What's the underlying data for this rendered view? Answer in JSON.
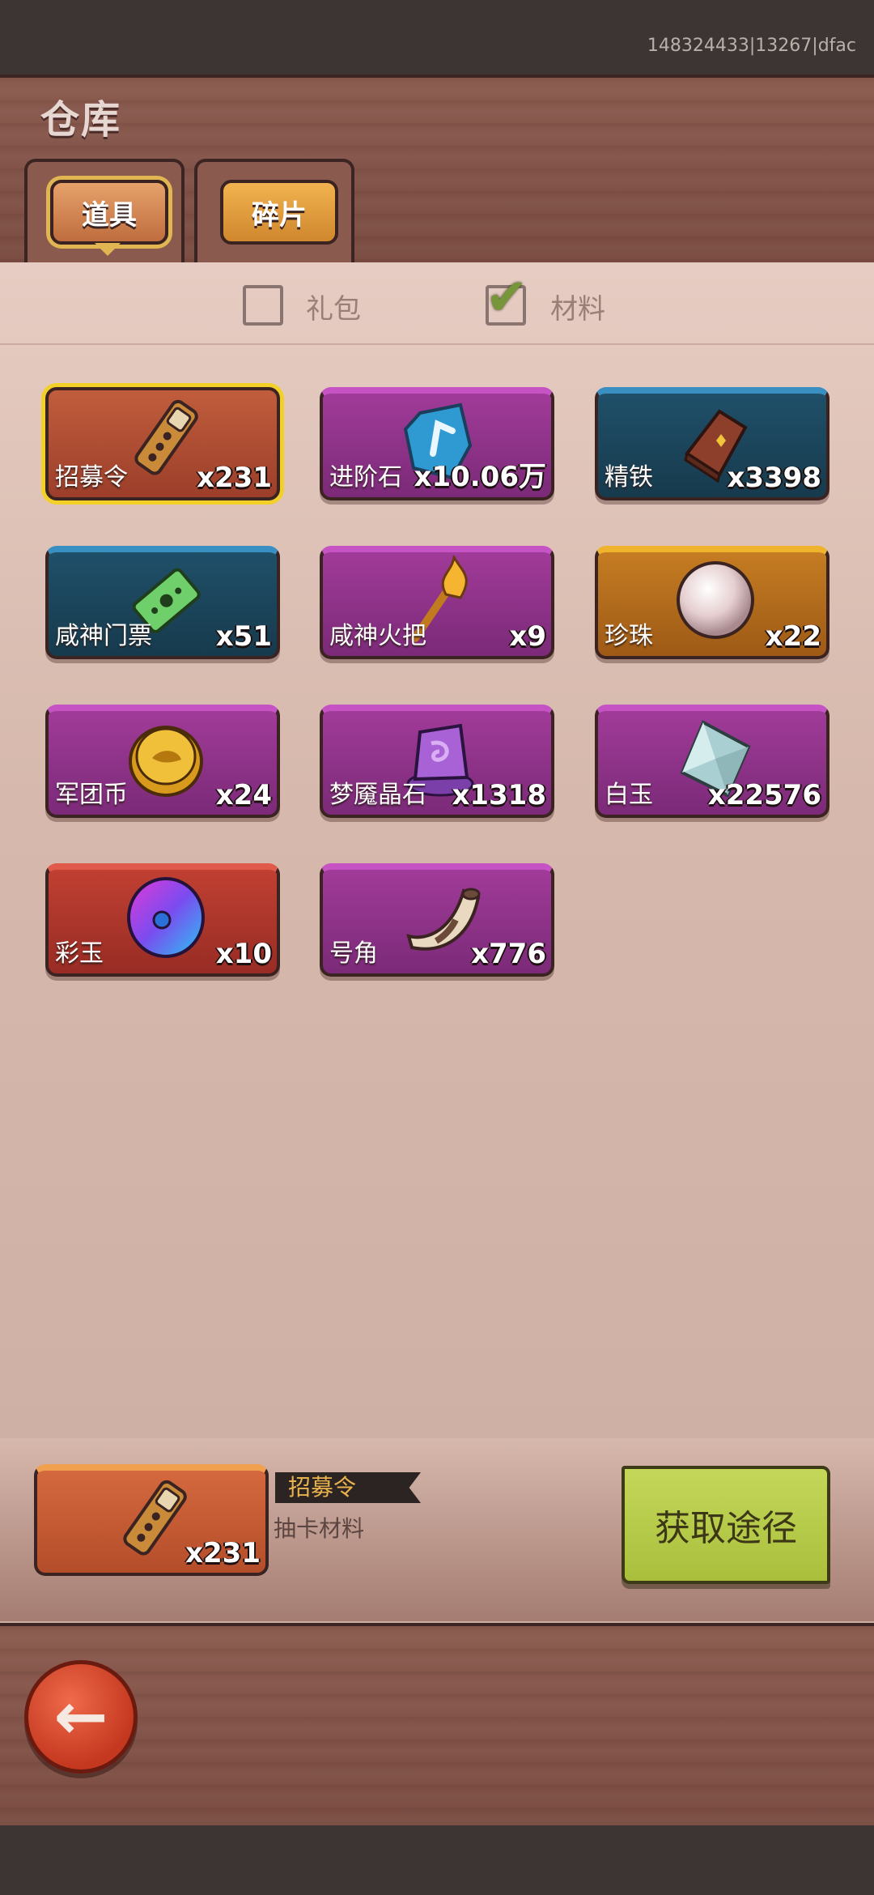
{
  "status": {
    "id_text": "148324433|13267|dfac"
  },
  "header": {
    "title": "仓库"
  },
  "tabs": [
    {
      "label": "道具",
      "selected": true
    },
    {
      "label": "碎片",
      "selected": false
    }
  ],
  "filters": [
    {
      "label": "礼包",
      "checked": false
    },
    {
      "label": "材料",
      "checked": true
    }
  ],
  "items": [
    {
      "name": "招募令",
      "count": "x231",
      "quality": "gold",
      "icon": "recruit-token-icon"
    },
    {
      "name": "进阶石",
      "count": "x10.06万",
      "quality": "purple",
      "icon": "advance-stone-icon"
    },
    {
      "name": "精铁",
      "count": "x3398",
      "quality": "blue",
      "icon": "iron-ingot-icon"
    },
    {
      "name": "咸神门票",
      "count": "x51",
      "quality": "blue",
      "icon": "ticket-icon"
    },
    {
      "name": "咸神火把",
      "count": "x9",
      "quality": "purple",
      "icon": "torch-icon"
    },
    {
      "name": "珍珠",
      "count": "x22",
      "quality": "orange",
      "icon": "pearl-icon"
    },
    {
      "name": "军团币",
      "count": "x24",
      "quality": "purple",
      "icon": "legion-coin-icon"
    },
    {
      "name": "梦魇晶石",
      "count": "x1318",
      "quality": "purple",
      "icon": "nightmare-crystal-icon"
    },
    {
      "name": "白玉",
      "count": "x22576",
      "quality": "purple",
      "icon": "white-jade-icon"
    },
    {
      "name": "彩玉",
      "count": "x10",
      "quality": "red",
      "icon": "color-jade-icon"
    },
    {
      "name": "号角",
      "count": "x776",
      "quality": "purple",
      "icon": "horn-icon"
    }
  ],
  "detail": {
    "name": "招募令",
    "description": "抽卡材料",
    "count": "x231",
    "get_button": "获取途径"
  },
  "footer": {
    "back_icon": "back-arrow-icon"
  }
}
